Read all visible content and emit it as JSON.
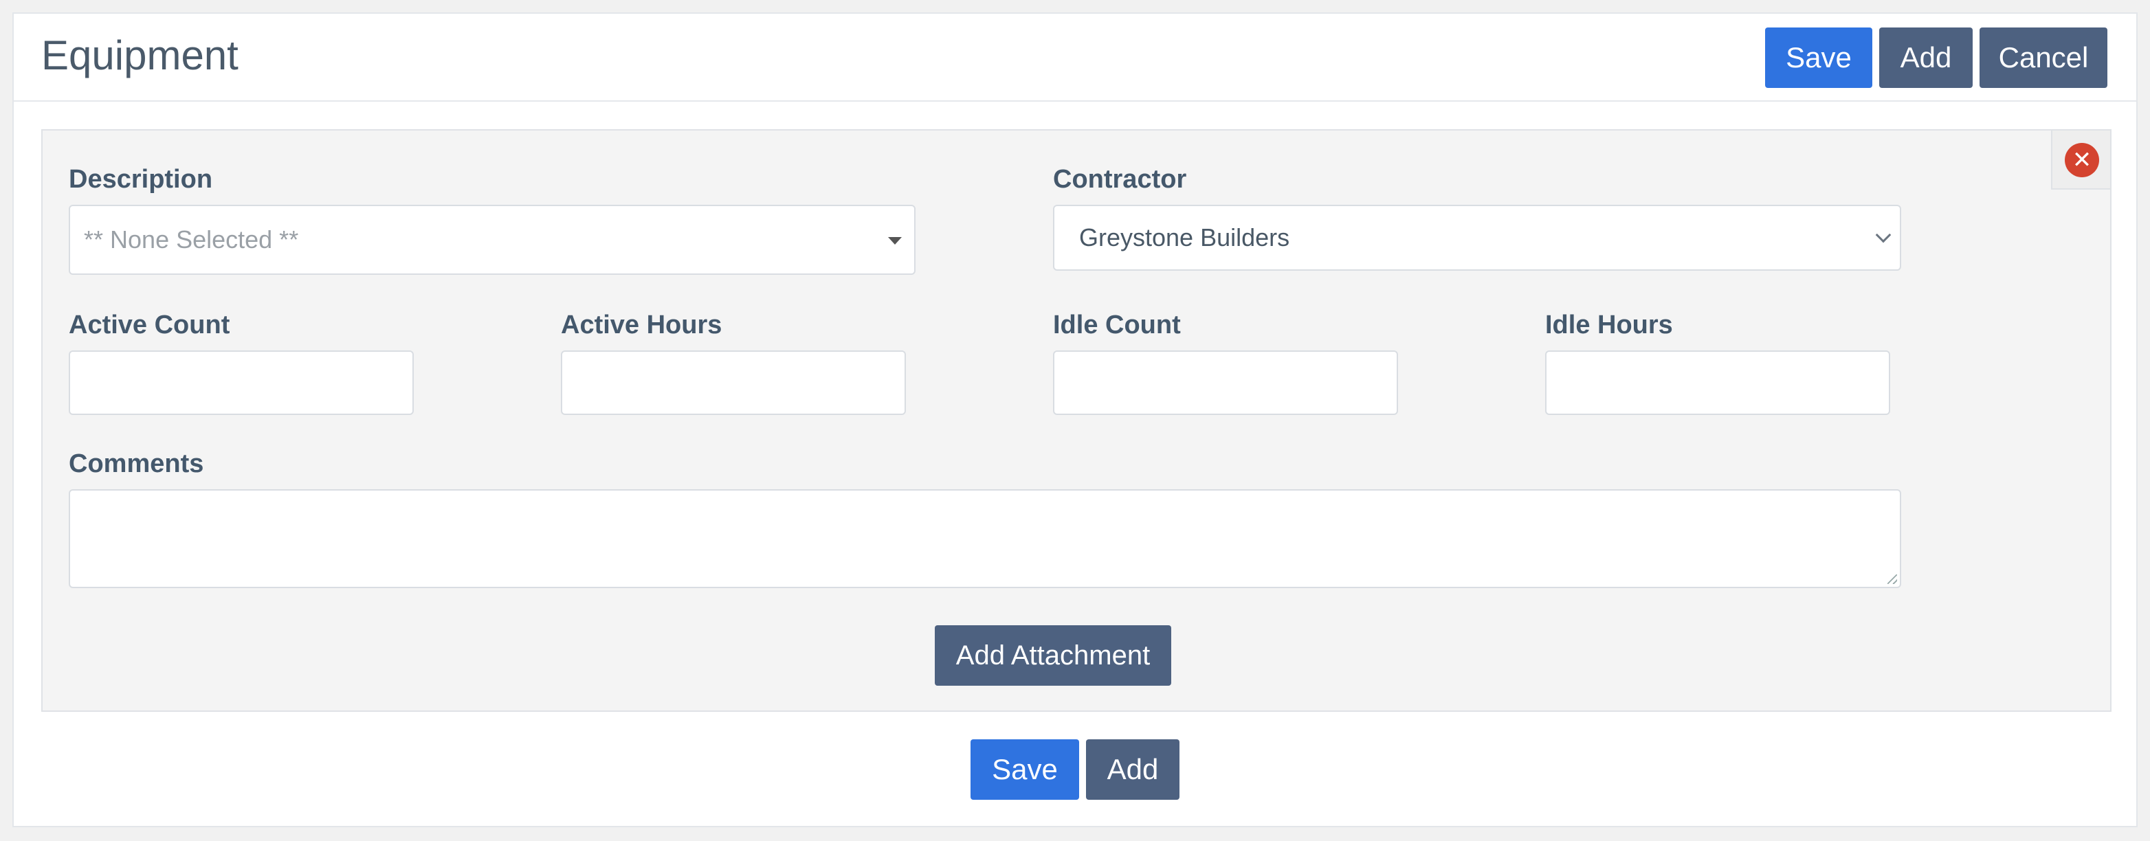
{
  "header": {
    "title": "Equipment",
    "buttons": {
      "save": "Save",
      "add": "Add",
      "cancel": "Cancel"
    }
  },
  "form": {
    "description": {
      "label": "Description",
      "placeholder": "** None Selected **",
      "value": ""
    },
    "contractor": {
      "label": "Contractor",
      "value": "Greystone Builders"
    },
    "active_count": {
      "label": "Active Count",
      "value": ""
    },
    "active_hours": {
      "label": "Active Hours",
      "value": ""
    },
    "idle_count": {
      "label": "Idle Count",
      "value": ""
    },
    "idle_hours": {
      "label": "Idle Hours",
      "value": ""
    },
    "comments": {
      "label": "Comments",
      "value": ""
    },
    "add_attachment_label": "Add Attachment",
    "remove_icon": "close-circle-icon",
    "remove_glyph": "✕"
  },
  "footer": {
    "buttons": {
      "save": "Save",
      "add": "Add"
    }
  },
  "colors": {
    "primary": "#2f73e0",
    "secondary": "#4d6180",
    "danger": "#d4432f",
    "panel_bg": "#f4f4f4"
  }
}
